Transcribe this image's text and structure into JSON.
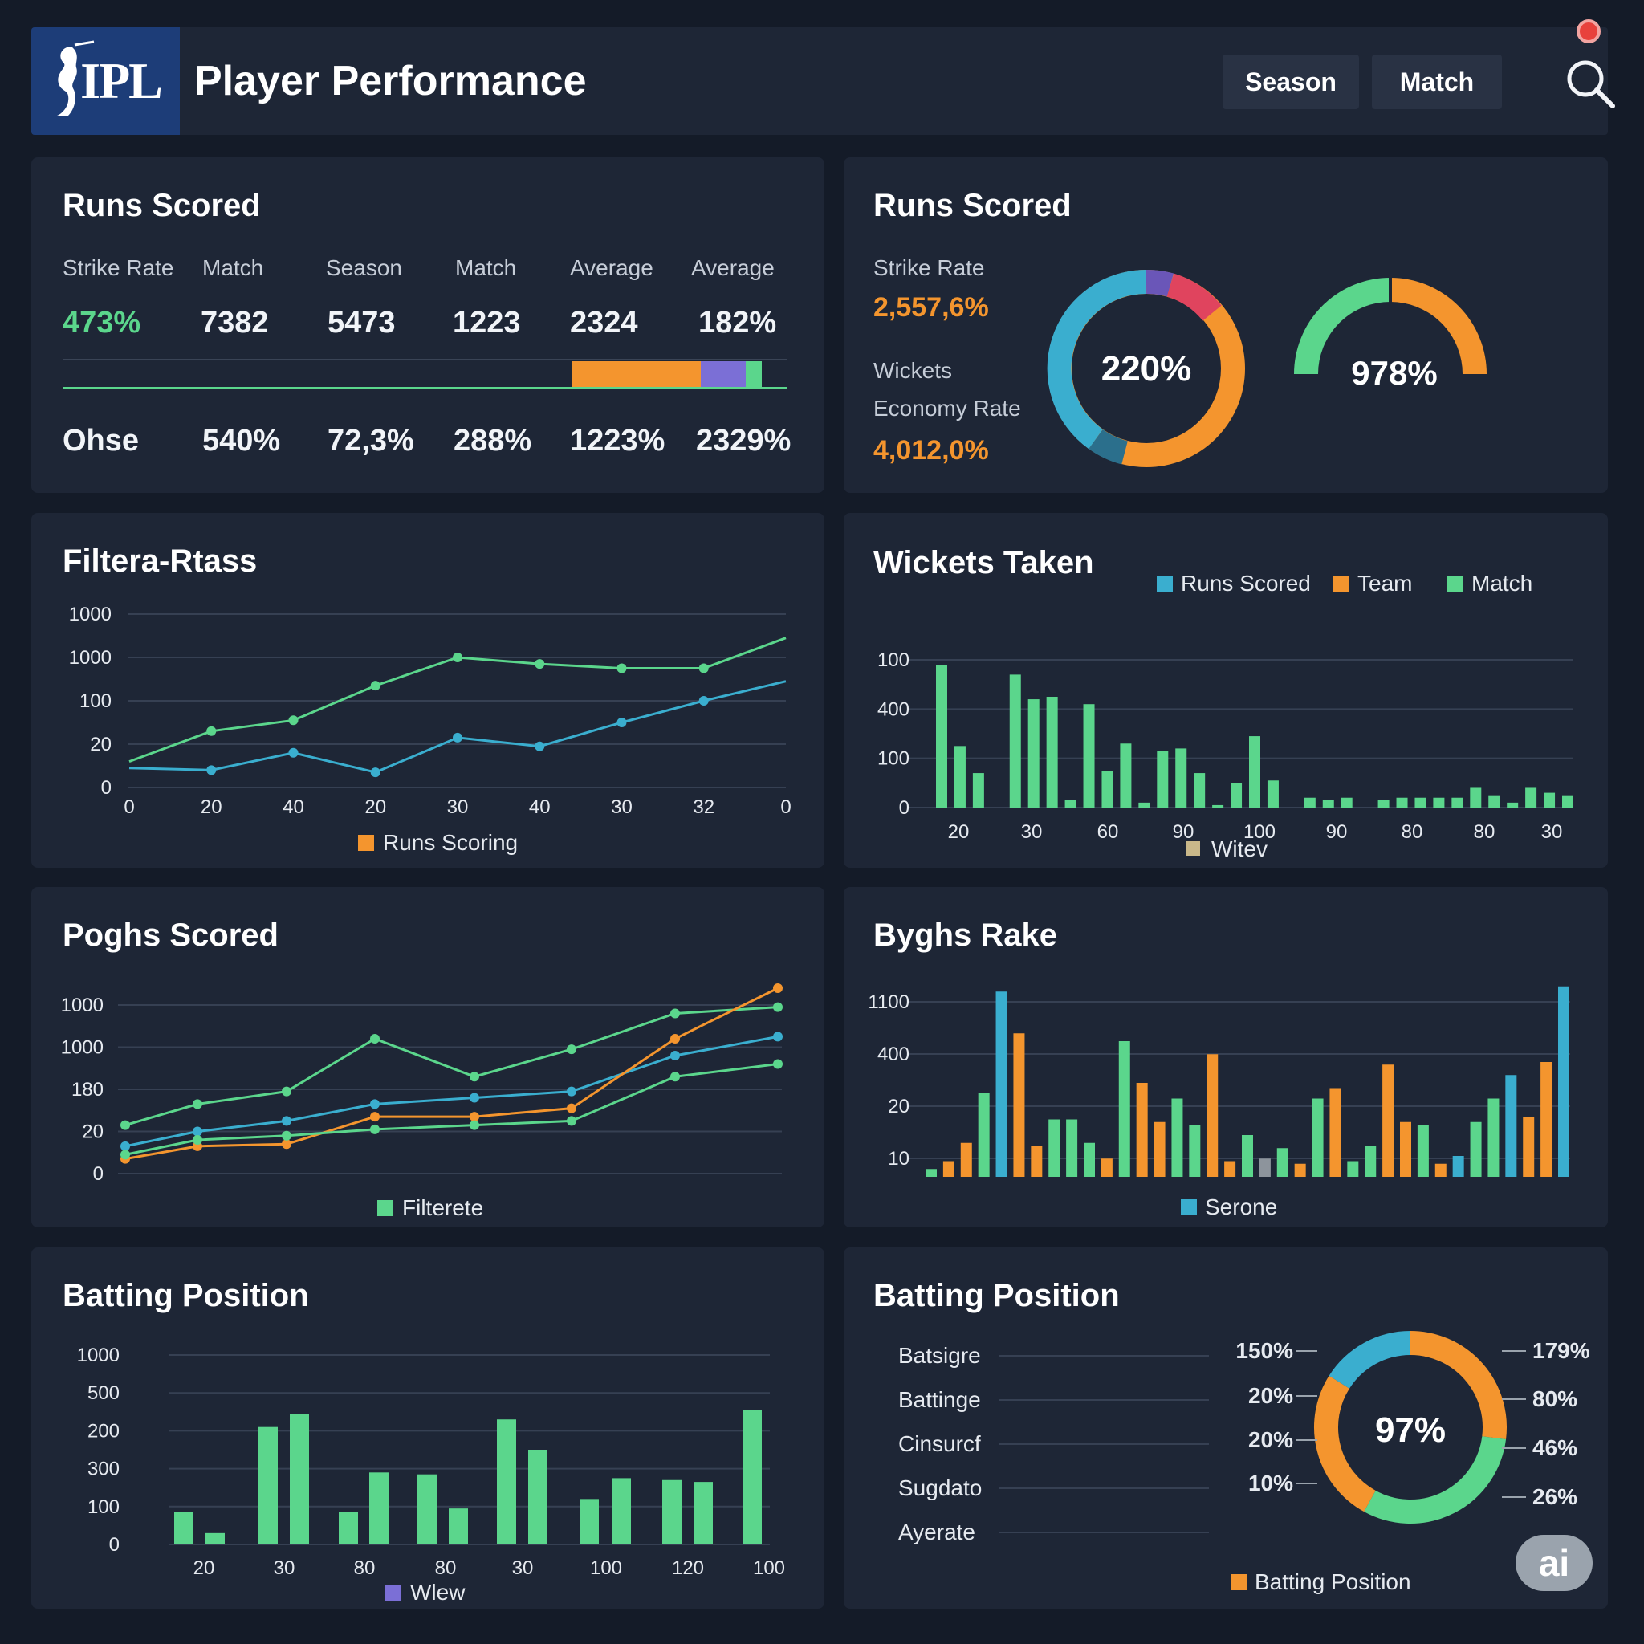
{
  "header": {
    "logo_text": "IPL",
    "title": "Player Performance",
    "buttons": [
      "Season",
      "Match"
    ]
  },
  "colors": {
    "green": "#5bd68c",
    "blue": "#3aaecf",
    "orange": "#f4952e",
    "purple": "#7b6fd6",
    "red": "#e0445e"
  },
  "stats_card": {
    "title": "Runs Scored",
    "labels": [
      "Strike Rate",
      "Match",
      "Season",
      "Match",
      "Average",
      "Average"
    ],
    "values": [
      "473%",
      "7382",
      "5473",
      "1223",
      "2324",
      "182%"
    ],
    "row2_label": "Ohse",
    "row2_values": [
      "540%",
      "72,3%",
      "288%",
      "1223%",
      "2329%"
    ]
  },
  "summary_card": {
    "title": "Runs Scored",
    "strike_label": "Strike Rate",
    "strike_value": "2,557,6%",
    "wickets_label": "Wickets",
    "economy_label": "Economy Rate",
    "economy_value": "4,012,0%",
    "donut_value": "220%",
    "gauge_value": "978%"
  },
  "icons": {
    "search": "search-icon",
    "notification": "notification-dot-icon",
    "logo": "batsman-logo-icon"
  },
  "badge": "ai",
  "chart_data": [
    {
      "type": "line",
      "title": "Filtera-Rtass",
      "y_ticks": [
        "1000",
        "1000",
        "100",
        "20",
        "0"
      ],
      "x_ticks": [
        "0",
        "20",
        "40",
        "20",
        "30",
        "40",
        "30",
        "32",
        "0"
      ],
      "legend": "Runs Scoring",
      "series": [
        {
          "color": "green",
          "values": [
            0.6,
            1.3,
            1.55,
            2.35,
            3.0,
            2.85,
            2.75,
            2.75,
            3.45
          ]
        },
        {
          "color": "blue",
          "values": [
            0.45,
            0.4,
            0.8,
            0.35,
            1.15,
            0.95,
            1.5,
            2.0,
            2.45
          ]
        }
      ]
    },
    {
      "type": "bar",
      "title": "Wickets Taken",
      "legend": [
        "Runs Scored",
        "Team",
        "Match"
      ],
      "legend_colors": [
        "blue",
        "orange",
        "green"
      ],
      "y_ticks": [
        "100",
        "400",
        "100",
        "0"
      ],
      "x_ticks": [
        "20",
        "30",
        "60",
        "90",
        "100",
        "90",
        "80",
        "80",
        "30"
      ],
      "bottom_legend": "Witev",
      "values": [
        2.9,
        1.25,
        0.7,
        0,
        2.7,
        2.2,
        2.25,
        0.15,
        2.1,
        0.75,
        1.3,
        0.1,
        1.15,
        1.2,
        0.7,
        0.05,
        0.5,
        1.45,
        0.55,
        0,
        0.2,
        0.15,
        0.2,
        0,
        0.15,
        0.2,
        0.2,
        0.2,
        0.2,
        0.4,
        0.25,
        0.1,
        0.4,
        0.3,
        0.25
      ]
    },
    {
      "type": "line",
      "title": "Poghs Scored",
      "y_ticks": [
        "1000",
        "1000",
        "180",
        "20",
        "0"
      ],
      "legend": "Filterete",
      "series": [
        {
          "color": "green",
          "values": [
            1.15,
            1.65,
            1.95,
            3.2,
            2.3,
            2.95,
            3.8,
            3.95
          ]
        },
        {
          "color": "blue",
          "values": [
            0.65,
            1.0,
            1.25,
            1.65,
            1.8,
            1.95,
            2.8,
            3.25
          ]
        },
        {
          "color": "orange",
          "values": [
            0.35,
            0.65,
            0.7,
            1.35,
            1.35,
            1.55,
            3.2,
            4.4
          ]
        },
        {
          "color": "green",
          "values": [
            0.45,
            0.8,
            0.9,
            1.05,
            1.15,
            1.25,
            2.3,
            2.6
          ]
        }
      ]
    },
    {
      "type": "bar",
      "title": "Byghs Rake",
      "y_ticks": [
        "1100",
        "400",
        "20",
        "10"
      ],
      "legend": "Serone",
      "bars": [
        [
          "green",
          0.15
        ],
        [
          "orange",
          0.3
        ],
        [
          "orange",
          0.65
        ],
        [
          "green",
          1.6
        ],
        [
          "blue",
          3.55
        ],
        [
          "orange",
          2.75
        ],
        [
          "orange",
          0.6
        ],
        [
          "green",
          1.1
        ],
        [
          "green",
          1.1
        ],
        [
          "green",
          0.65
        ],
        [
          "orange",
          0.35
        ],
        [
          "green",
          2.6
        ],
        [
          "orange",
          1.8
        ],
        [
          "orange",
          1.05
        ],
        [
          "green",
          1.5
        ],
        [
          "green",
          1.0
        ],
        [
          "orange",
          2.35
        ],
        [
          "orange",
          0.3
        ],
        [
          "green",
          0.8
        ],
        [
          "gray",
          0.35
        ],
        [
          "green",
          0.55
        ],
        [
          "orange",
          0.25
        ],
        [
          "green",
          1.5
        ],
        [
          "orange",
          1.7
        ],
        [
          "green",
          0.3
        ],
        [
          "green",
          0.6
        ],
        [
          "orange",
          2.15
        ],
        [
          "orange",
          1.05
        ],
        [
          "green",
          1.0
        ],
        [
          "orange",
          0.25
        ],
        [
          "blue",
          0.4
        ],
        [
          "green",
          1.05
        ],
        [
          "green",
          1.5
        ],
        [
          "blue",
          1.95
        ],
        [
          "orange",
          1.15
        ],
        [
          "orange",
          2.2
        ],
        [
          "blue",
          3.65
        ]
      ]
    },
    {
      "type": "bar",
      "title": "Batting Position",
      "y_ticks": [
        "1000",
        "500",
        "200",
        "300",
        "100",
        "0"
      ],
      "x_ticks": [
        "20",
        "30",
        "80",
        "80",
        "30",
        "100",
        "120",
        "100"
      ],
      "legend": "Wlew",
      "values": [
        0.85,
        0.3,
        3.1,
        3.45,
        0.85,
        1.9,
        1.85,
        0.95,
        3.3,
        2.5,
        1.2,
        1.75,
        1.7,
        1.65,
        3.55
      ]
    },
    {
      "type": "pie",
      "title": "Batting Position",
      "rows": [
        "Batsigre",
        "Battinge",
        "Cinsurcf",
        "Sugdato",
        "Ayerate"
      ],
      "center": "97%",
      "left_labels": [
        "150%",
        "20%",
        "20%",
        "10%"
      ],
      "right_labels": [
        "179%",
        "80%",
        "46%",
        "26%"
      ],
      "legend": "Batting Position",
      "slices": [
        {
          "color": "orange",
          "value": 0.27
        },
        {
          "color": "green",
          "value": 0.31
        },
        {
          "color": "orange",
          "value": 0.26
        },
        {
          "color": "blue",
          "value": 0.16
        }
      ]
    }
  ]
}
